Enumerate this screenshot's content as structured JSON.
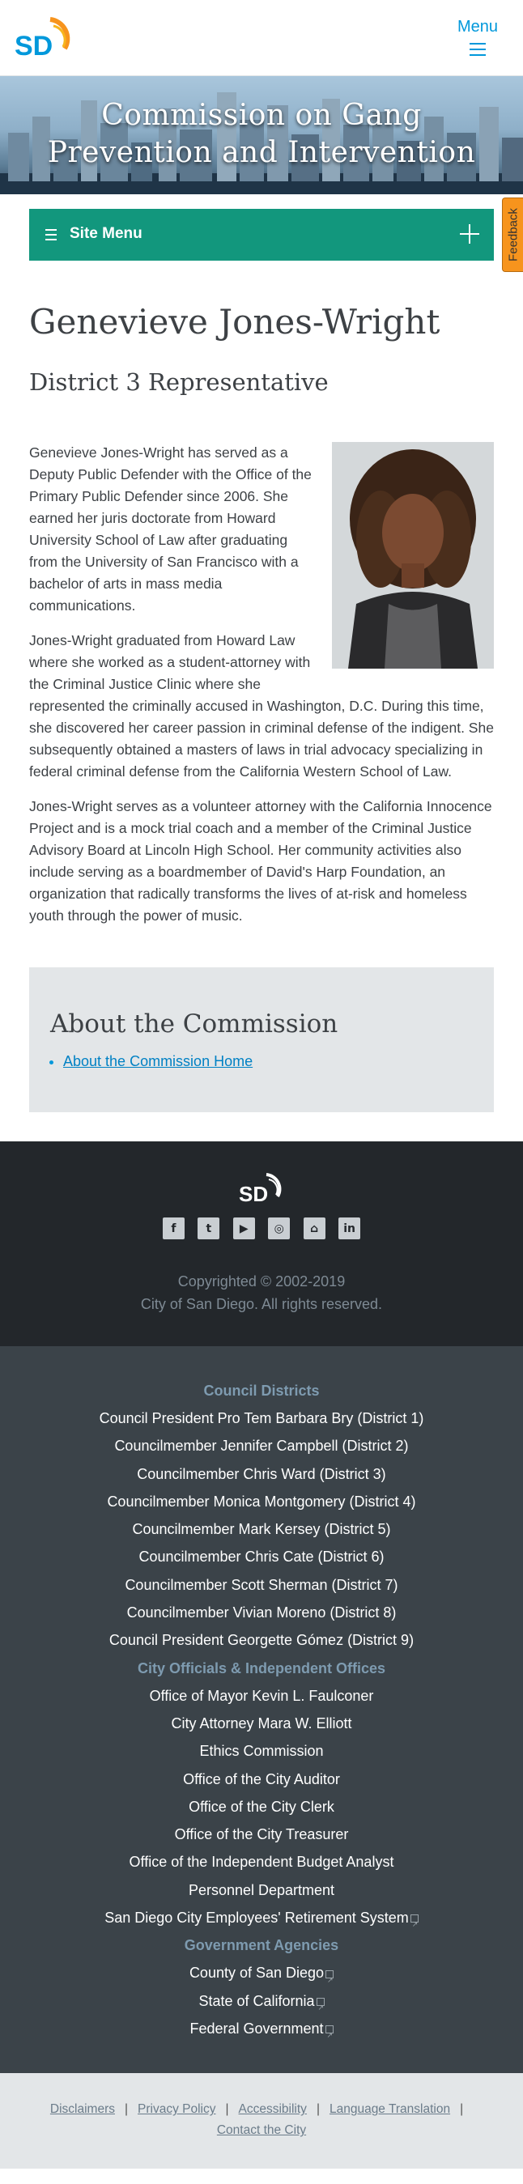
{
  "header": {
    "logo_text": "SD",
    "menu_label": "Menu"
  },
  "hero": {
    "title_line1": "Commission on Gang",
    "title_line2": "Prevention and Intervention"
  },
  "feedback_label": "Feedback",
  "site_menu": {
    "label": "Site Menu"
  },
  "main": {
    "name": "Genevieve Jones-Wright",
    "role": "District 3 Representative",
    "paragraphs": [
      "Genevieve Jones-Wright has served as a Deputy Public Defender with the Office of the Primary Public Defender since 2006. She earned her juris doctorate from Howard University School of Law after graduating from the University of San Francisco with a bachelor of arts in mass media communications.",
      "Jones-Wright graduated from Howard Law where she worked as a student-attorney with the Criminal Justice Clinic where she represented the criminally accused in Washington, D.C. During this time, she discovered her career passion in criminal defense of the indigent. She subsequently obtained a masters of laws in trial advocacy specializing in federal criminal defense from the California Western School of Law.",
      "Jones-Wright serves as a volunteer attorney with the California Innocence Project and is a mock trial coach and a member of the Criminal Justice Advisory Board at Lincoln High School. Her community activities also include serving as a boardmember of David's Harp Foundation, an organization that radically transforms the lives of at-risk and homeless youth through the power of music."
    ]
  },
  "about": {
    "heading": "About the Commission",
    "link": "About the Commission Home"
  },
  "footer": {
    "social_icons": [
      "facebook-icon",
      "twitter-icon",
      "youtube-icon",
      "instagram-icon",
      "nextdoor-icon",
      "linkedin-icon"
    ],
    "copyright_line1": "Copyrighted © 2002-2019",
    "copyright_line2": "City of San Diego. All rights reserved."
  },
  "links": {
    "council_title": "Council Districts",
    "council": [
      "Council President Pro Tem Barbara Bry (District 1)",
      "Councilmember Jennifer Campbell (District 2)",
      "Councilmember Chris Ward (District 3)",
      "Councilmember Monica Montgomery (District 4)",
      "Councilmember Mark Kersey (District 5)",
      "Councilmember Chris Cate (District 6)",
      "Councilmember Scott Sherman (District 7)",
      "Councilmember Vivian Moreno (District 8)",
      "Council President Georgette Gómez (District 9)"
    ],
    "officials_title": "City Officials & Independent Offices",
    "officials": [
      "Office of Mayor Kevin L. Faulconer",
      "City Attorney Mara W. Elliott",
      "Ethics Commission",
      "Office of the City Auditor",
      "Office of the City Clerk",
      "Office of the City Treasurer",
      "Office of the Independent Budget Analyst",
      "Personnel Department",
      "San Diego City Employees' Retirement System"
    ],
    "agencies_title": "Government Agencies",
    "agencies": [
      "County of San Diego",
      "State of California",
      "Federal Government"
    ]
  },
  "bottom": {
    "disclaimers": "Disclaimers",
    "privacy": "Privacy Policy",
    "accessibility": "Accessibility",
    "language": "Language Translation",
    "contact": "Contact the City",
    "separator": "|"
  },
  "colors": {
    "brand_blue": "#0098db",
    "brand_orange": "#f7941d",
    "site_menu_green": "#12977d"
  }
}
